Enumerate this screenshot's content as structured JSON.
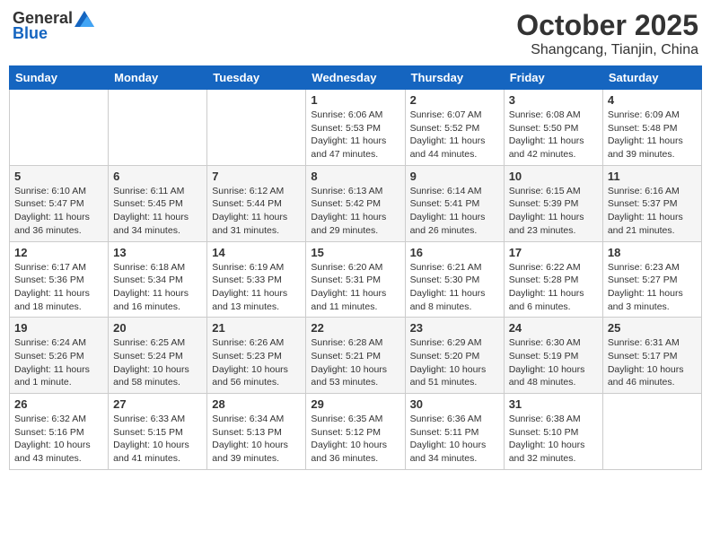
{
  "header": {
    "logo_general": "General",
    "logo_blue": "Blue",
    "month": "October 2025",
    "location": "Shangcang, Tianjin, China"
  },
  "weekdays": [
    "Sunday",
    "Monday",
    "Tuesday",
    "Wednesday",
    "Thursday",
    "Friday",
    "Saturday"
  ],
  "weeks": [
    [
      {
        "day": "",
        "info": ""
      },
      {
        "day": "",
        "info": ""
      },
      {
        "day": "",
        "info": ""
      },
      {
        "day": "1",
        "info": "Sunrise: 6:06 AM\nSunset: 5:53 PM\nDaylight: 11 hours and 47 minutes."
      },
      {
        "day": "2",
        "info": "Sunrise: 6:07 AM\nSunset: 5:52 PM\nDaylight: 11 hours and 44 minutes."
      },
      {
        "day": "3",
        "info": "Sunrise: 6:08 AM\nSunset: 5:50 PM\nDaylight: 11 hours and 42 minutes."
      },
      {
        "day": "4",
        "info": "Sunrise: 6:09 AM\nSunset: 5:48 PM\nDaylight: 11 hours and 39 minutes."
      }
    ],
    [
      {
        "day": "5",
        "info": "Sunrise: 6:10 AM\nSunset: 5:47 PM\nDaylight: 11 hours and 36 minutes."
      },
      {
        "day": "6",
        "info": "Sunrise: 6:11 AM\nSunset: 5:45 PM\nDaylight: 11 hours and 34 minutes."
      },
      {
        "day": "7",
        "info": "Sunrise: 6:12 AM\nSunset: 5:44 PM\nDaylight: 11 hours and 31 minutes."
      },
      {
        "day": "8",
        "info": "Sunrise: 6:13 AM\nSunset: 5:42 PM\nDaylight: 11 hours and 29 minutes."
      },
      {
        "day": "9",
        "info": "Sunrise: 6:14 AM\nSunset: 5:41 PM\nDaylight: 11 hours and 26 minutes."
      },
      {
        "day": "10",
        "info": "Sunrise: 6:15 AM\nSunset: 5:39 PM\nDaylight: 11 hours and 23 minutes."
      },
      {
        "day": "11",
        "info": "Sunrise: 6:16 AM\nSunset: 5:37 PM\nDaylight: 11 hours and 21 minutes."
      }
    ],
    [
      {
        "day": "12",
        "info": "Sunrise: 6:17 AM\nSunset: 5:36 PM\nDaylight: 11 hours and 18 minutes."
      },
      {
        "day": "13",
        "info": "Sunrise: 6:18 AM\nSunset: 5:34 PM\nDaylight: 11 hours and 16 minutes."
      },
      {
        "day": "14",
        "info": "Sunrise: 6:19 AM\nSunset: 5:33 PM\nDaylight: 11 hours and 13 minutes."
      },
      {
        "day": "15",
        "info": "Sunrise: 6:20 AM\nSunset: 5:31 PM\nDaylight: 11 hours and 11 minutes."
      },
      {
        "day": "16",
        "info": "Sunrise: 6:21 AM\nSunset: 5:30 PM\nDaylight: 11 hours and 8 minutes."
      },
      {
        "day": "17",
        "info": "Sunrise: 6:22 AM\nSunset: 5:28 PM\nDaylight: 11 hours and 6 minutes."
      },
      {
        "day": "18",
        "info": "Sunrise: 6:23 AM\nSunset: 5:27 PM\nDaylight: 11 hours and 3 minutes."
      }
    ],
    [
      {
        "day": "19",
        "info": "Sunrise: 6:24 AM\nSunset: 5:26 PM\nDaylight: 11 hours and 1 minute."
      },
      {
        "day": "20",
        "info": "Sunrise: 6:25 AM\nSunset: 5:24 PM\nDaylight: 10 hours and 58 minutes."
      },
      {
        "day": "21",
        "info": "Sunrise: 6:26 AM\nSunset: 5:23 PM\nDaylight: 10 hours and 56 minutes."
      },
      {
        "day": "22",
        "info": "Sunrise: 6:28 AM\nSunset: 5:21 PM\nDaylight: 10 hours and 53 minutes."
      },
      {
        "day": "23",
        "info": "Sunrise: 6:29 AM\nSunset: 5:20 PM\nDaylight: 10 hours and 51 minutes."
      },
      {
        "day": "24",
        "info": "Sunrise: 6:30 AM\nSunset: 5:19 PM\nDaylight: 10 hours and 48 minutes."
      },
      {
        "day": "25",
        "info": "Sunrise: 6:31 AM\nSunset: 5:17 PM\nDaylight: 10 hours and 46 minutes."
      }
    ],
    [
      {
        "day": "26",
        "info": "Sunrise: 6:32 AM\nSunset: 5:16 PM\nDaylight: 10 hours and 43 minutes."
      },
      {
        "day": "27",
        "info": "Sunrise: 6:33 AM\nSunset: 5:15 PM\nDaylight: 10 hours and 41 minutes."
      },
      {
        "day": "28",
        "info": "Sunrise: 6:34 AM\nSunset: 5:13 PM\nDaylight: 10 hours and 39 minutes."
      },
      {
        "day": "29",
        "info": "Sunrise: 6:35 AM\nSunset: 5:12 PM\nDaylight: 10 hours and 36 minutes."
      },
      {
        "day": "30",
        "info": "Sunrise: 6:36 AM\nSunset: 5:11 PM\nDaylight: 10 hours and 34 minutes."
      },
      {
        "day": "31",
        "info": "Sunrise: 6:38 AM\nSunset: 5:10 PM\nDaylight: 10 hours and 32 minutes."
      },
      {
        "day": "",
        "info": ""
      }
    ]
  ]
}
